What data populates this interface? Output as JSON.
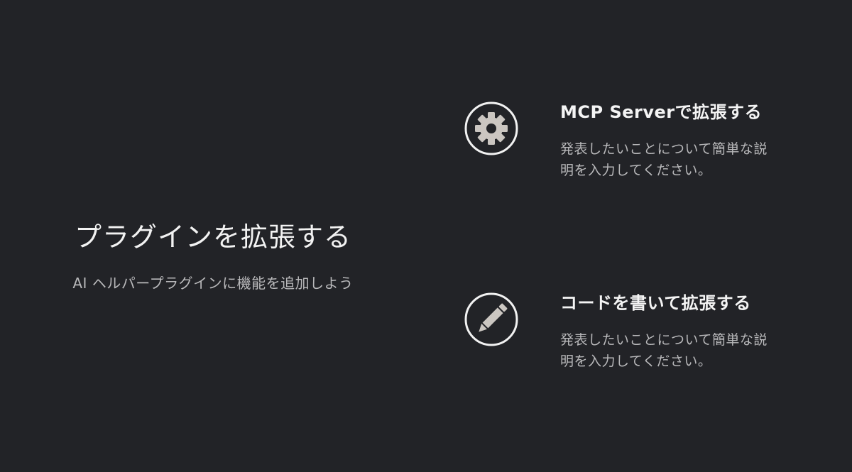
{
  "colors": {
    "background": "#222327",
    "icon_fill": "#cbc6c1",
    "icon_ring": "#f2f2f2"
  },
  "left": {
    "title": "プラグインを拡張する",
    "subtitle": "AI ヘルパープラグインに機能を追加しよう"
  },
  "features": [
    {
      "icon": "gear-icon",
      "title": "MCP Serverで拡張する",
      "description": "発表したいことについて簡単な説明を入力してください。"
    },
    {
      "icon": "pencil-icon",
      "title": "コードを書いて拡張する",
      "description": "発表したいことについて簡単な説明を入力してください。"
    }
  ]
}
